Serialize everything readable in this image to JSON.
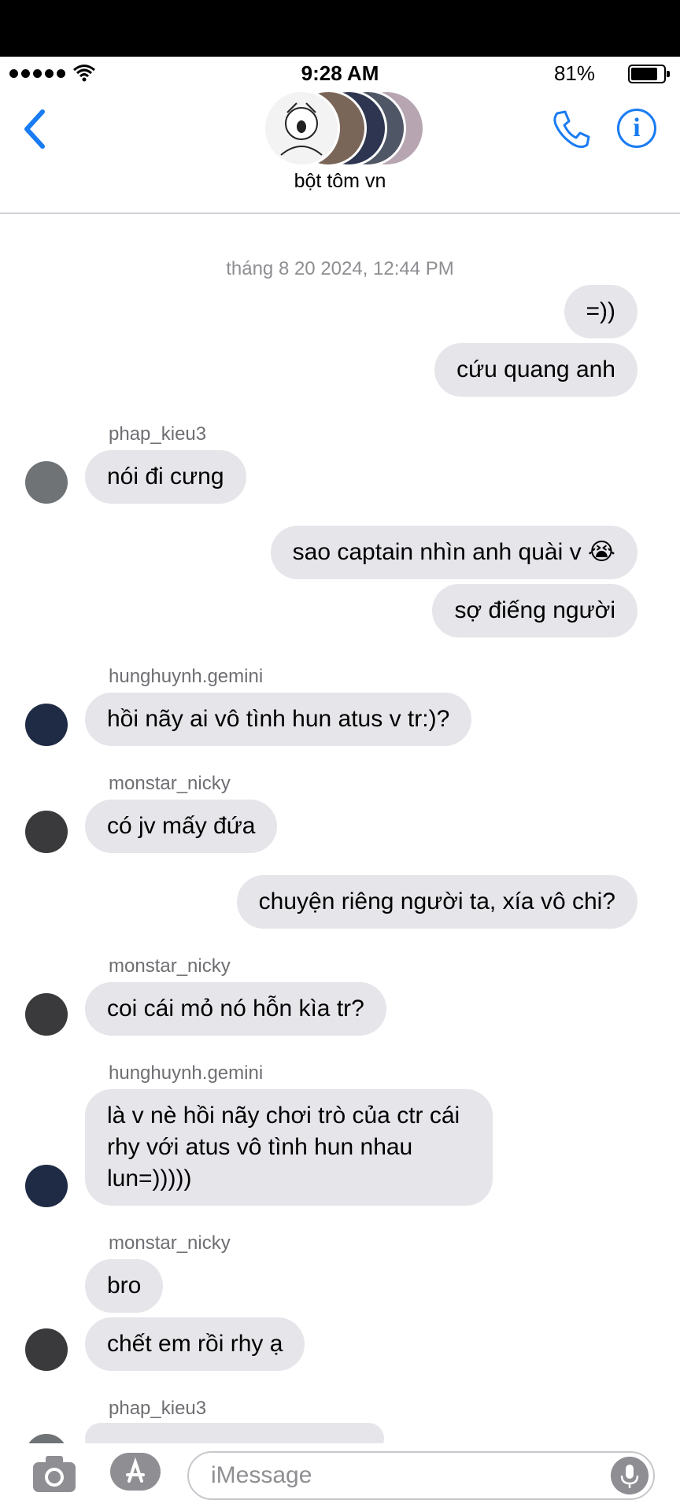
{
  "status_bar": {
    "time": "9:28 AM",
    "battery": "81%",
    "battery_level": 0.81,
    "icons": [
      "signal-dots-icon",
      "wifi-icon",
      "battery-icon"
    ]
  },
  "header": {
    "group_name": "bột tôm vn",
    "icons": [
      "back-chevron-icon",
      "phone-icon",
      "info-icon"
    ]
  },
  "timestamp": "tháng 8 20 2024, 12:44 PM",
  "messages": [
    {
      "text": "=))"
    },
    {
      "text": "cứu quang anh"
    },
    {
      "sender": "phap_kieu3",
      "text": "nói đi cưng"
    },
    {
      "text": "sao captain nhìn anh quài v 😭"
    },
    {
      "text": "sợ điếng người"
    },
    {
      "sender": "hunghuynh.gemini",
      "text": "hồi nãy ai vô tình hun atus v tr:)?"
    },
    {
      "sender": "monstar_nicky",
      "text": "có jv mấy đứa"
    },
    {
      "text": "chuyện riêng người ta, xía vô chi?"
    },
    {
      "sender": "monstar_nicky",
      "text": "coi cái mỏ nó hỗn kìa tr?"
    },
    {
      "sender": "hunghuynh.gemini",
      "text": "là v nè hồi nãy chơi trò của ctr cái rhy với atus vô tình hun nhau lun=)))))"
    },
    {
      "sender": "monstar_nicky",
      "text": "bro"
    },
    {
      "text": "chết em rồi rhy ạ"
    },
    {
      "sender": "phap_kieu3",
      "text": ""
    }
  ],
  "composer": {
    "placeholder": "iMessage",
    "icons": [
      "camera-icon",
      "app-store-icon",
      "microphone-icon"
    ]
  },
  "colors": {
    "accent": "#1a7cf2",
    "bubble": "#e5e5ea",
    "secondary_text": "#8e8e93"
  }
}
